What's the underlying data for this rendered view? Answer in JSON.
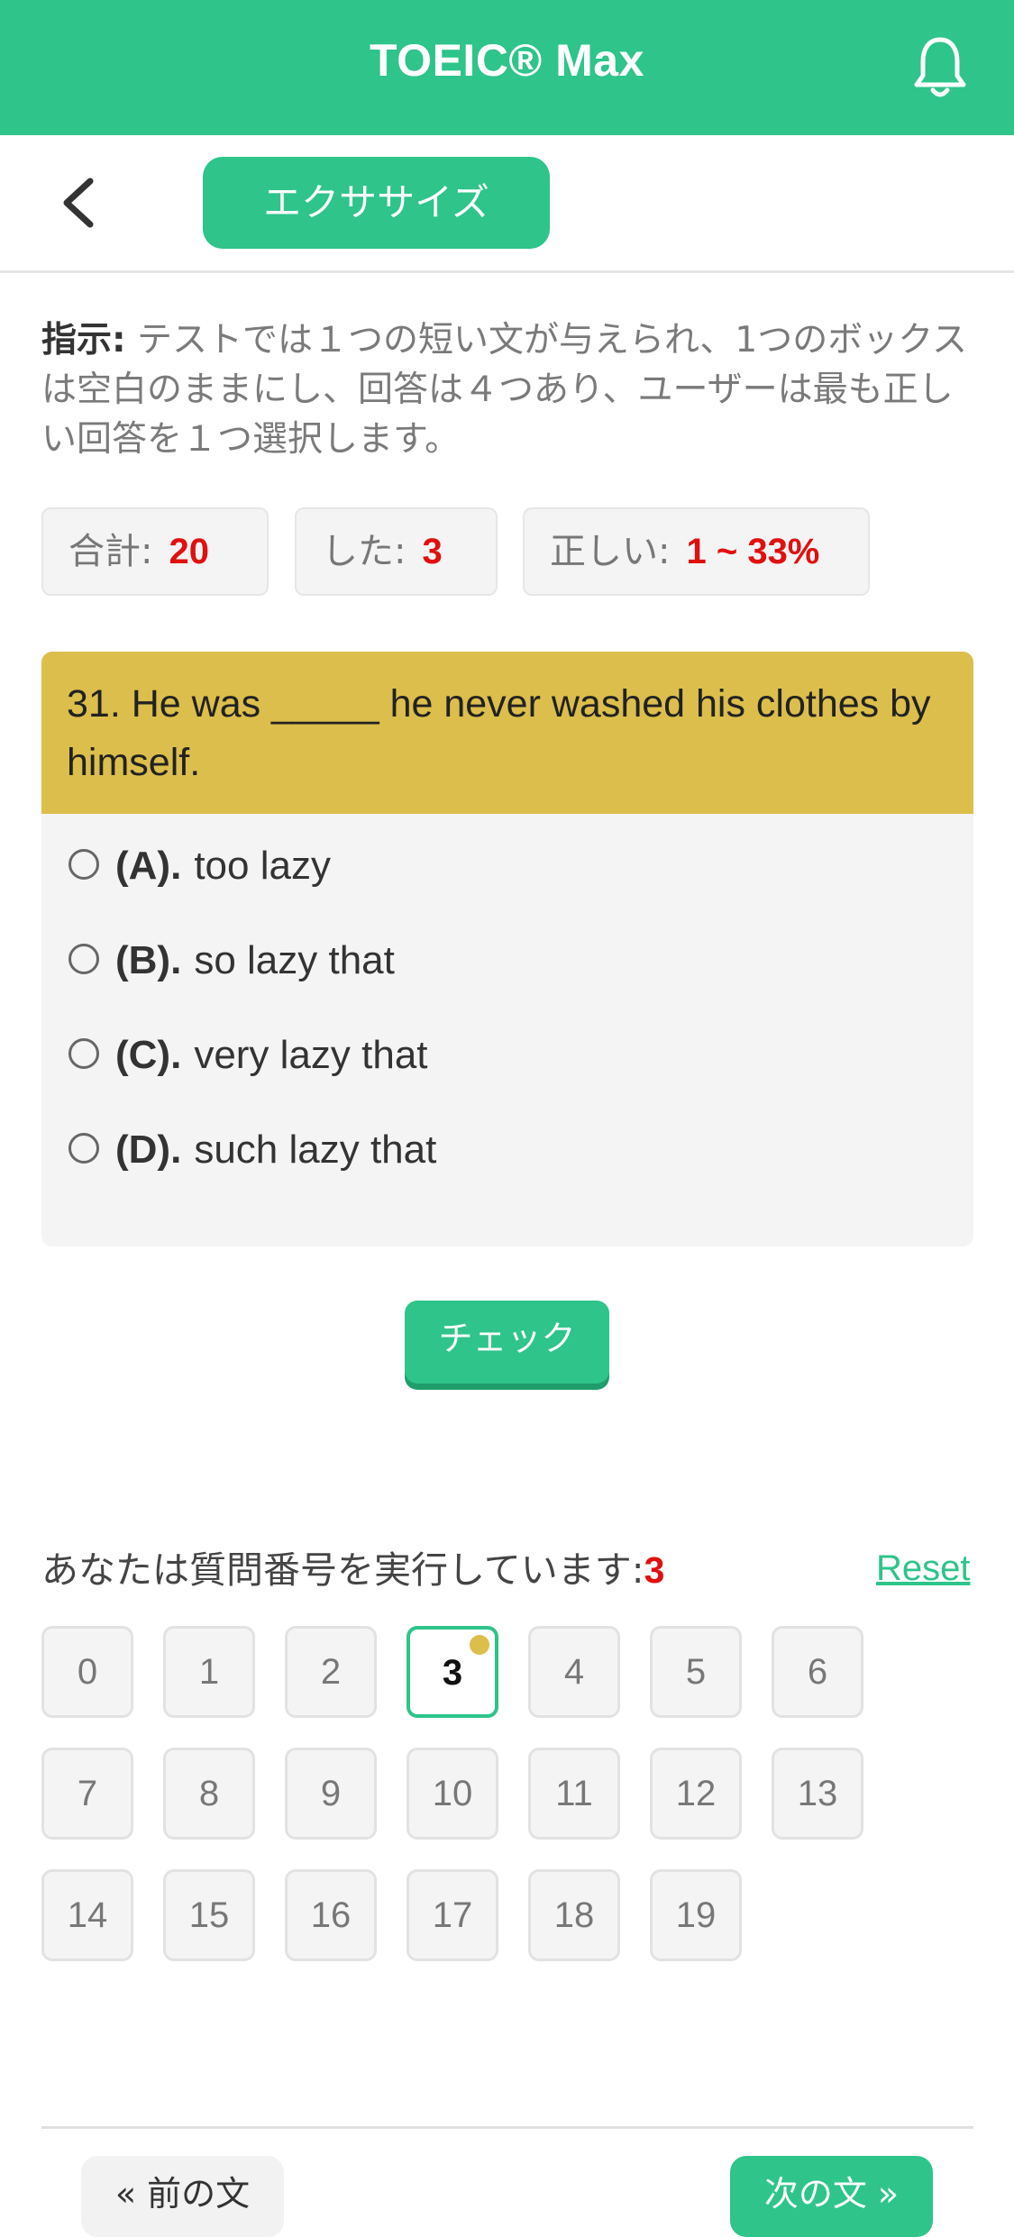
{
  "app": {
    "title": "TOEIC® Max",
    "icons": {
      "notifications": "bell-icon",
      "back": "chevron-left-icon"
    }
  },
  "subheader": {
    "section_title": "エクササイズ"
  },
  "instruction": {
    "label": "指示:",
    "text": " テストでは１つの短い文が与えられ、1つのボックスは空白のままにし、回答は４つあり、ユーザーは最も正しい回答を１つ選択します。"
  },
  "stats": {
    "total_label": "合計:",
    "total_value": "20",
    "done_label": "した:",
    "done_value": "3",
    "correct_label": "正しい:",
    "correct_value": "1 ~ 33%"
  },
  "question": {
    "text": "31. He was _____ he never washed his clothes by himself.",
    "options": [
      {
        "letter": "(A).",
        "text": "too lazy"
      },
      {
        "letter": "(B).",
        "text": "so lazy that"
      },
      {
        "letter": "(C).",
        "text": "very lazy that"
      },
      {
        "letter": "(D).",
        "text": "such lazy that"
      }
    ],
    "check_label": "チェック"
  },
  "progress": {
    "label": "あなたは質問番号を実行しています:",
    "current": "3",
    "reset_label": "Reset",
    "numbers": [
      "0",
      "1",
      "2",
      "3",
      "4",
      "5",
      "6",
      "7",
      "8",
      "9",
      "10",
      "11",
      "12",
      "13",
      "14",
      "15",
      "16",
      "17",
      "18",
      "19"
    ]
  },
  "nav": {
    "prev_label": "« 前の文",
    "next_label": "次の文 »"
  },
  "colors": {
    "primary": "#2ec48a",
    "question_header": "#dcbe4c",
    "highlight": "#e01010"
  }
}
